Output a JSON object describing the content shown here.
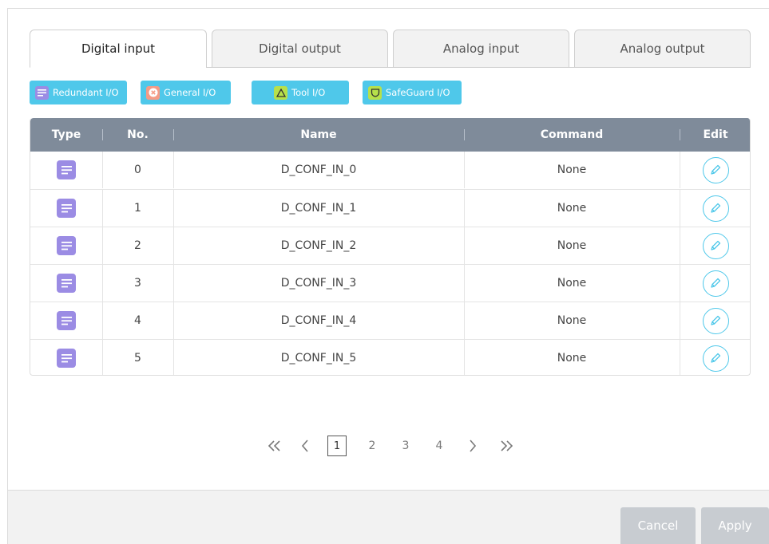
{
  "tabs": [
    {
      "label": "Digital input",
      "active": true
    },
    {
      "label": "Digital output",
      "active": false
    },
    {
      "label": "Analog input",
      "active": false
    },
    {
      "label": "Analog output",
      "active": false
    }
  ],
  "legend": [
    {
      "label": "Redundant I/O",
      "icon": "lines-icon",
      "icon_color": "#9b8ce4"
    },
    {
      "label": "General I/O",
      "icon": "x-circle-icon",
      "icon_color": "#f59b86"
    },
    {
      "label": "Tool I/O",
      "icon": "triangle-icon",
      "icon_color": "#b7e04a"
    },
    {
      "label": "SafeGuard I/O",
      "icon": "shield-icon",
      "icon_color": "#b7e04a"
    }
  ],
  "table": {
    "columns": {
      "type": "Type",
      "no": "No.",
      "name": "Name",
      "command": "Command",
      "edit": "Edit"
    },
    "rows": [
      {
        "type": "redundant",
        "no": "0",
        "name": "D_CONF_IN_0",
        "command": "None"
      },
      {
        "type": "redundant",
        "no": "1",
        "name": "D_CONF_IN_1",
        "command": "None"
      },
      {
        "type": "redundant",
        "no": "2",
        "name": "D_CONF_IN_2",
        "command": "None"
      },
      {
        "type": "redundant",
        "no": "3",
        "name": "D_CONF_IN_3",
        "command": "None"
      },
      {
        "type": "redundant",
        "no": "4",
        "name": "D_CONF_IN_4",
        "command": "None"
      },
      {
        "type": "redundant",
        "no": "5",
        "name": "D_CONF_IN_5",
        "command": "None"
      }
    ]
  },
  "pagination": {
    "first": "«",
    "prev": "‹",
    "next": "›",
    "last": "»",
    "pages": [
      "1",
      "2",
      "3",
      "4"
    ],
    "current": "1"
  },
  "footer": {
    "cancel_label": "Cancel",
    "apply_label": "Apply"
  },
  "colors": {
    "accent": "#4fc8ea",
    "header": "#7f8b9a",
    "redundant": "#9b8ce4",
    "button_disabled": "#c8ccd1"
  }
}
